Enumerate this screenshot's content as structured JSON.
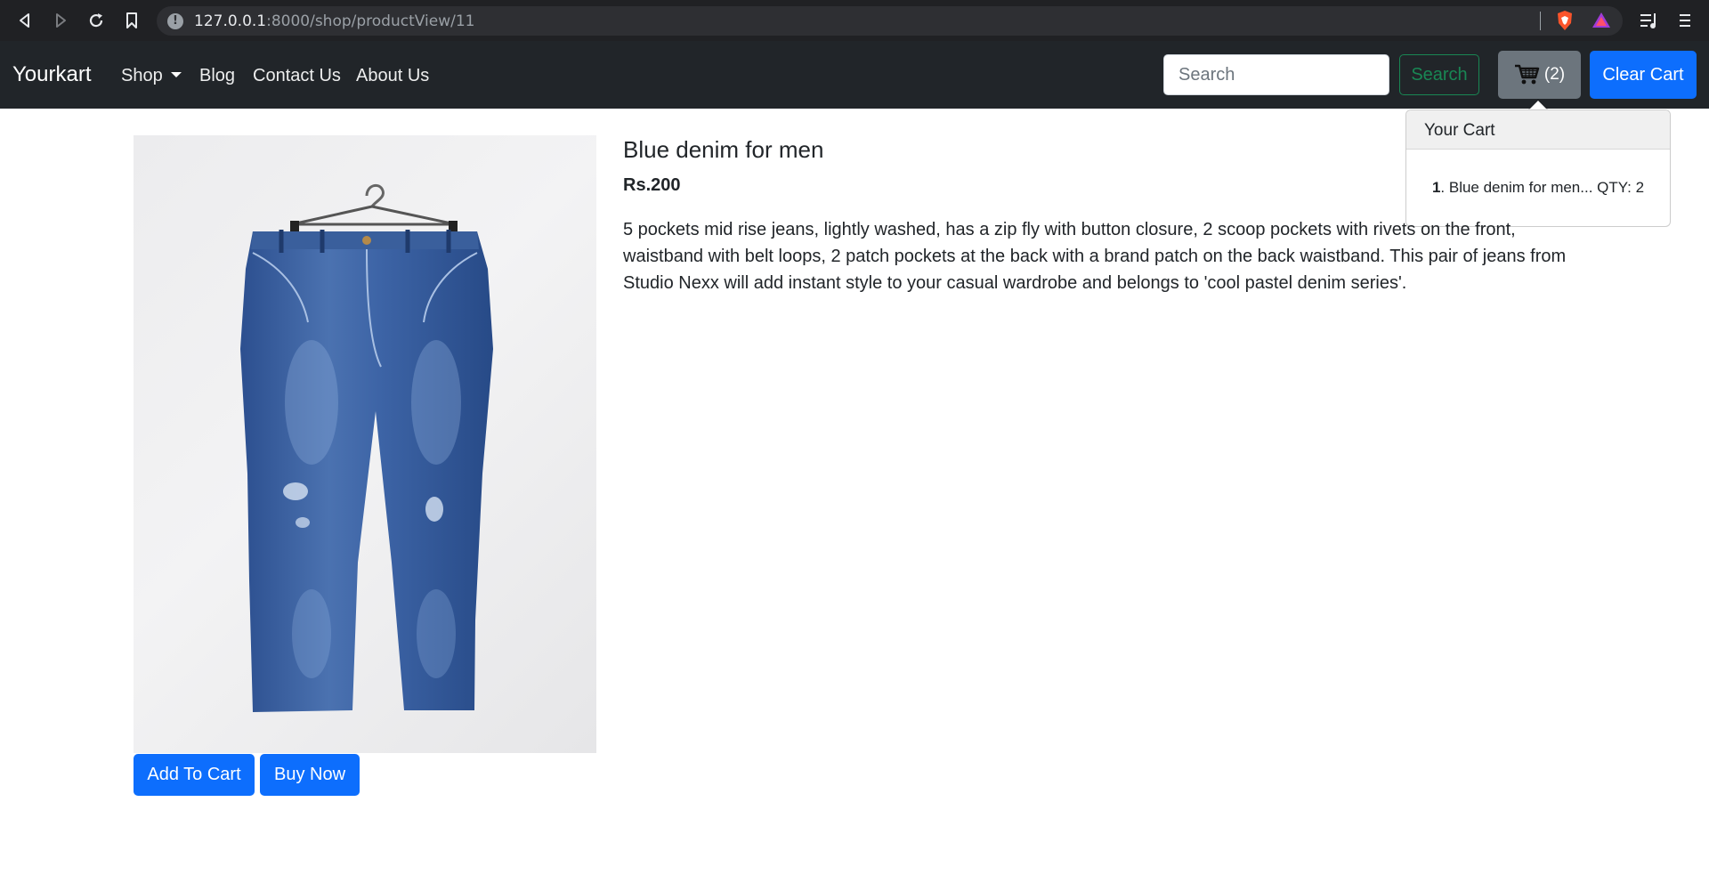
{
  "browser": {
    "url_host": "127.0.0.1",
    "url_path": ":8000/shop/productView/11"
  },
  "navbar": {
    "brand": "Yourkart",
    "links": [
      "Shop",
      "Blog",
      "Contact Us",
      "About Us"
    ],
    "search_placeholder": "Search",
    "search_button": "Search",
    "cart_count": "(2)",
    "clear_cart": "Clear Cart"
  },
  "cart_popover": {
    "title": "Your Cart",
    "items": [
      {
        "index": "1",
        "text": ". Blue denim for men... QTY: 2"
      }
    ]
  },
  "product": {
    "title": "Blue denim for men",
    "price": "Rs.200",
    "description": "5 pockets mid rise jeans, lightly washed, has a zip fly with button closure, 2 scoop pockets with rivets on the front, waistband with belt loops, 2 patch pockets at the back with a brand patch on the back waistband. This pair of jeans from Studio Nexx will add instant style to your casual wardrobe and belongs to 'cool pastel denim series'.",
    "image_name": "blue-denim-jeans-image"
  },
  "actions": {
    "add_to_cart": "Add To Cart",
    "buy_now": "Buy Now"
  },
  "colors": {
    "navbar_bg": "#212529",
    "primary": "#0d6efd",
    "success": "#198754",
    "secondary": "#6c757d"
  }
}
